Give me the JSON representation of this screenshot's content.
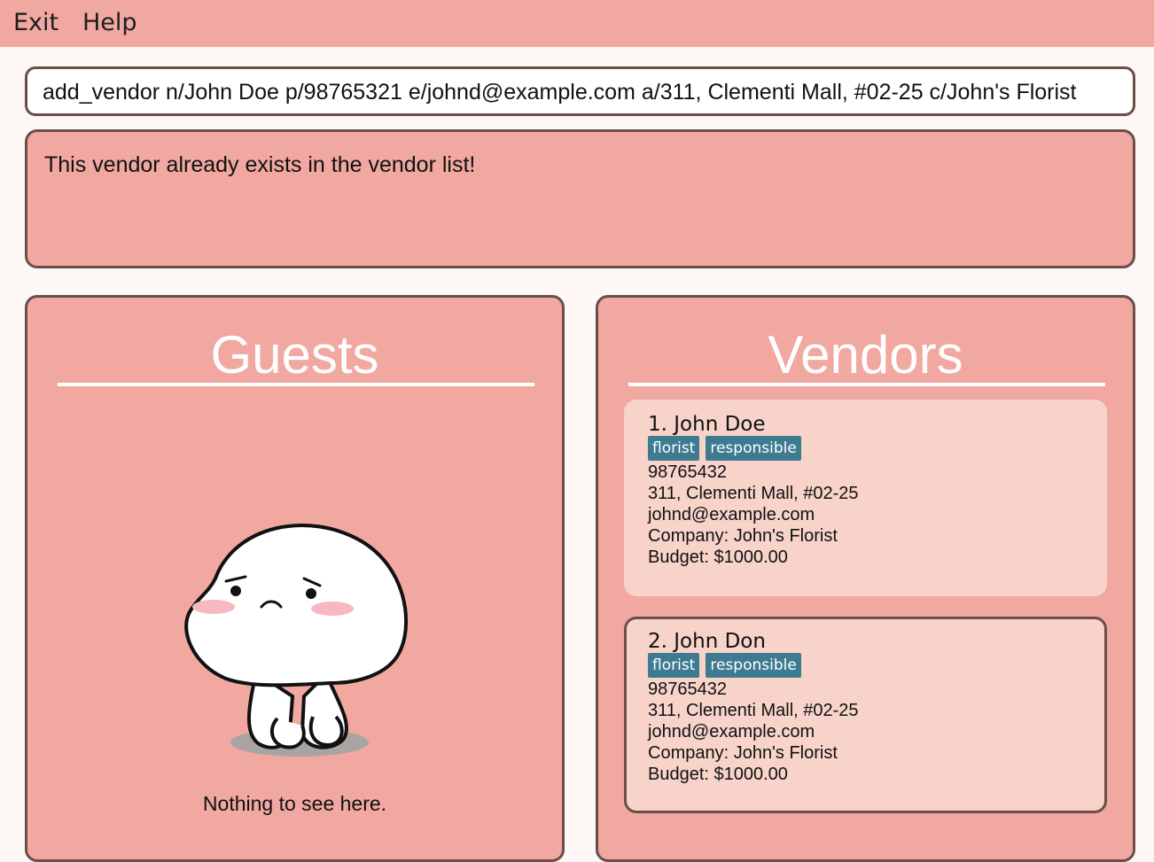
{
  "menu": {
    "exit_label": "Exit",
    "help_label": "Help"
  },
  "command": {
    "value": "add_vendor n/John Doe p/98765321 e/johnd@example.com a/311, Clementi Mall, #02-25 c/John's Florist"
  },
  "result": {
    "message": "This vendor already exists in the vendor list!"
  },
  "guests": {
    "title": "Guests",
    "empty_message": "Nothing to see here."
  },
  "vendors": {
    "title": "Vendors",
    "items": [
      {
        "name": "1. John Doe",
        "tags": [
          "florist",
          "responsible"
        ],
        "phone": "98765432",
        "address": "311, Clementi Mall, #02-25",
        "email": "johnd@example.com",
        "company": "Company: John's Florist",
        "budget": "Budget: $1000.00"
      },
      {
        "name": "2. John Don",
        "tags": [
          "florist",
          "responsible"
        ],
        "phone": "98765432",
        "address": "311, Clementi Mall, #02-25",
        "email": "johnd@example.com",
        "company": "Company: John's Florist",
        "budget": "Budget: $1000.00"
      }
    ]
  },
  "colors": {
    "menubar": "#f0a8a0",
    "panel": "#f0a8a0",
    "card": "#f7d3ca",
    "border": "#6b4d4a",
    "tag": "#3e7b91"
  }
}
